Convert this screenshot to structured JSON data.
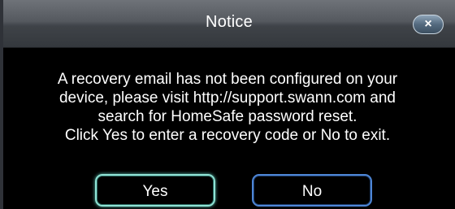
{
  "dialog": {
    "title": "Notice",
    "close_icon": "close-icon",
    "close_glyph": "×",
    "message_lines": [
      "A recovery email has not been configured on your",
      "device, please visit http://support.swann.com and",
      "search for HomeSafe password reset.",
      "Click Yes to enter a recovery code or No to exit."
    ],
    "buttons": {
      "yes_label": "Yes",
      "no_label": "No"
    }
  },
  "colors": {
    "background": "#000000",
    "title_text": "#ffffff",
    "yes_border": "#8fe3d5",
    "no_border": "#4e86d6"
  }
}
